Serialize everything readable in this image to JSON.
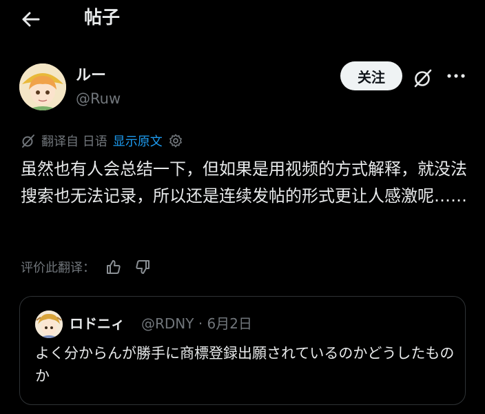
{
  "header": {
    "title": "帖子"
  },
  "author": {
    "name": "ルー",
    "handle": "@Ruw",
    "follow_label": "关注"
  },
  "translation": {
    "prefix": "翻译自 日语",
    "show_original": "显示原文"
  },
  "post": {
    "text": "虽然也有人会总结一下，但如果是用视频的方式解释，就没法搜索也无法记录，所以还是连续发帖的形式更让人感激呢……"
  },
  "rating": {
    "label": "评价此翻译："
  },
  "quote": {
    "name": "ロドニィ",
    "meta": "@RDNY · 6月2日",
    "text": "よく分からんが勝手に商標登録出願されているのかどうしたものか"
  }
}
